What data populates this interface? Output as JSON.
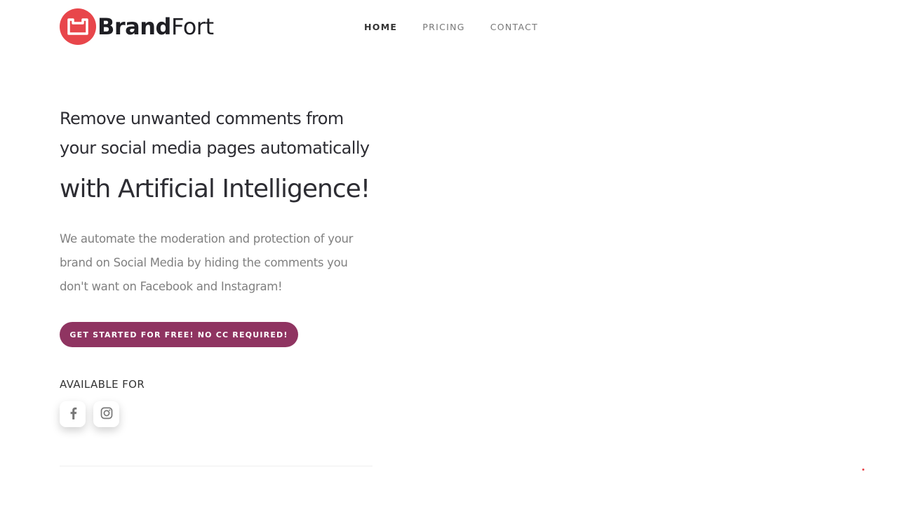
{
  "brand": {
    "name_bold": "Brand",
    "name_light": "Fort",
    "accent": "#e8464b",
    "logo_icon": "box-icon"
  },
  "nav": {
    "items": [
      {
        "label": "HOME",
        "active": true
      },
      {
        "label": "PRICING",
        "active": false
      },
      {
        "label": "CONTACT",
        "active": false
      }
    ]
  },
  "hero": {
    "heading": "Remove unwanted comments from your social media pages automatically",
    "subheading": "with Artificial Intelligence!",
    "description": "We automate the moderation and protection of your brand on Social Media by hiding the comments you don't want on Facebook and Instagram!",
    "cta_label": "GET STARTED FOR FREE! NO CC REQUIRED!",
    "cta_color": "#8f3461"
  },
  "availability": {
    "label": "AVAILABLE FOR",
    "platforms": [
      {
        "icon": "facebook-icon"
      },
      {
        "icon": "instagram-icon"
      }
    ]
  }
}
